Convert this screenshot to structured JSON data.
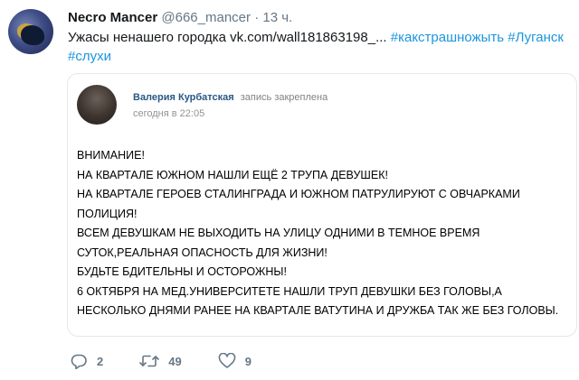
{
  "tweet": {
    "display_name": "Necro Mancer",
    "handle": "@666_mancer",
    "dot": "·",
    "time": "13 ч.",
    "text_prefix": "Ужасы ненашего городка ",
    "link": "vk.com/wall181863198_...",
    "hashtags": [
      "#какстрашножыть",
      "#Луганск",
      "#слухи"
    ],
    "avatar_icon": "avatar-image"
  },
  "quoted_post": {
    "author": "Валерия Курбатская",
    "action": "запись закреплена",
    "date": "сегодня в 22:05",
    "body": "ВНИМАНИЕ!\nНА КВАРТАЛЕ ЮЖНОМ НАШЛИ ЕЩЁ 2 ТРУПА ДЕВУШЕК!\nНА КВАРТАЛЕ ГЕРОЕВ СТАЛИНГРАДА И ЮЖНОМ ПАТРУЛИРУЮТ С ОВЧАРКАМИ ПОЛИЦИЯ!\nВСЕМ ДЕВУШКАМ НЕ ВЫХОДИТЬ НА УЛИЦУ ОДНИМИ В ТЕМНОЕ ВРЕМЯ СУТОК,РЕАЛЬНАЯ ОПАСНОСТЬ ДЛЯ ЖИЗНИ!\nБУДЬТЕ БДИТЕЛЬНЫ И ОСТОРОЖНЫ!\n6 ОКТЯБРЯ НА МЕД.УНИВЕРСИТЕТЕ НАШЛИ ТРУП ДЕВУШКИ БЕЗ ГОЛОВЫ,А НЕСКОЛЬКО ДНЯМИ РАНЕЕ НА КВАРТАЛЕ ВАТУТИНА И ДРУЖБА ТАК ЖЕ БЕЗ ГОЛОВЫ."
  },
  "actions": {
    "reply": {
      "icon": "reply-icon",
      "count": "2"
    },
    "retweet": {
      "icon": "retweet-icon",
      "count": "49"
    },
    "like": {
      "icon": "heart-icon",
      "count": "9"
    }
  },
  "colors": {
    "hashtag": "#1b95e0",
    "vk_name": "#2a5885",
    "muted": "#657786"
  }
}
